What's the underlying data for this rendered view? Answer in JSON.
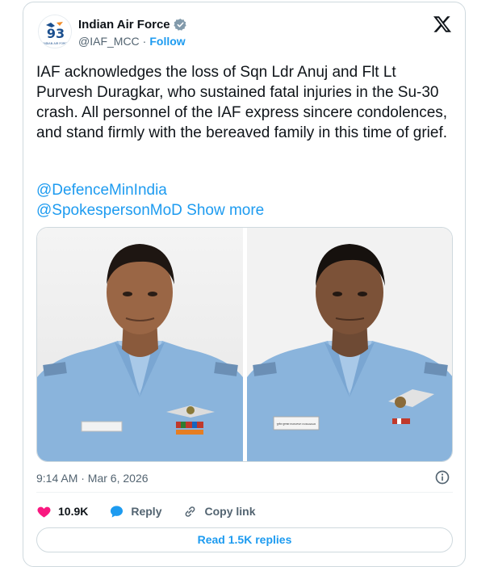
{
  "author": {
    "name": "Indian Air Force",
    "handle": "@IAF_MCC",
    "separator": "·",
    "follow_label": "Follow",
    "avatar_text": "93",
    "avatar_caption": "INDIAN AIR FORCE"
  },
  "tweet": {
    "text": "IAF acknowledges the loss of Sqn Ldr Anuj and Flt Lt Purvesh Duragkar, who sustained fatal injuries in the Su-30 crash. All personnel of the IAF express sincere condolences, and stand firmly with the bereaved family in this time of grief.",
    "mentions": [
      "@DefenceMinIndia",
      "@SpokespersonMoD"
    ],
    "show_more_label": "Show more"
  },
  "media": {
    "photos": [
      {
        "name_tag": ""
      },
      {
        "name_tag": "पुरवेश दुरगकर PURVESH DURAGKAR"
      }
    ]
  },
  "meta": {
    "timestamp": "9:14 AM · Mar 6, 2026"
  },
  "actions": {
    "like_count": "10.9K",
    "reply_label": "Reply",
    "copy_link_label": "Copy link"
  },
  "footer": {
    "read_replies_label": "Read 1.5K replies"
  },
  "colors": {
    "accent": "#1d9bf0",
    "like_red": "#f91880",
    "verified_gray": "#829aab",
    "text_secondary": "#536471",
    "uniform_blue": "#8ab4dc"
  },
  "icons": [
    "iaf-logo-icon",
    "verified-icon",
    "x-logo-icon",
    "info-icon",
    "heart-icon",
    "reply-icon",
    "link-icon"
  ]
}
